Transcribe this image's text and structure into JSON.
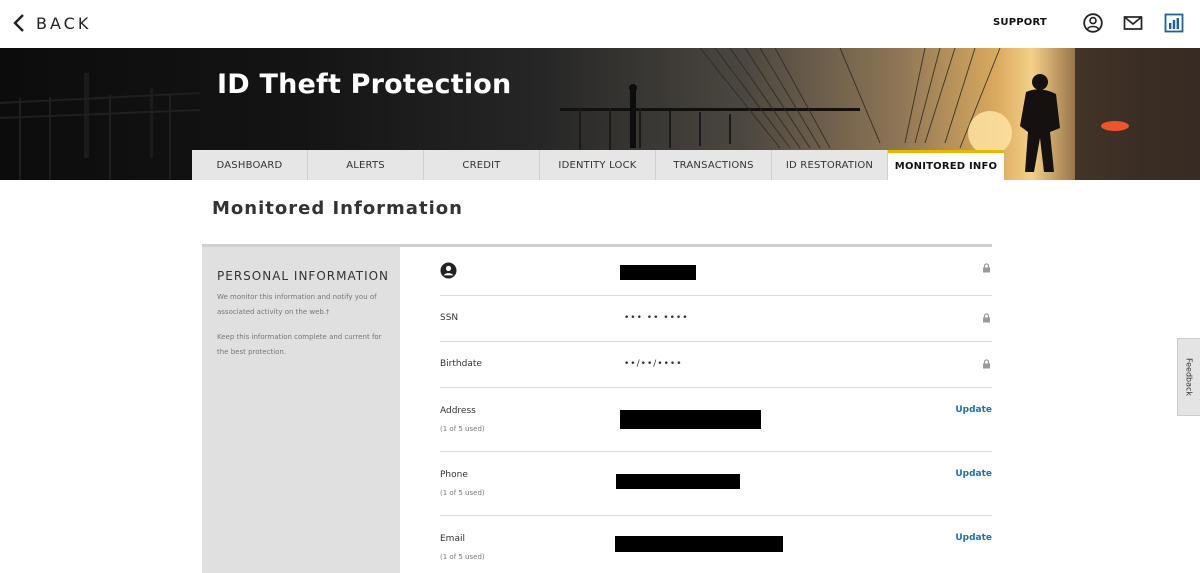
{
  "header": {
    "back_label": "BACK",
    "support_label": "SUPPORT",
    "icons": [
      "user-account-icon",
      "mail-icon",
      "dashboard-chart-icon"
    ]
  },
  "banner": {
    "title": "ID Theft Protection"
  },
  "tabs": [
    {
      "label": "DASHBOARD",
      "active": false
    },
    {
      "label": "ALERTS",
      "active": false
    },
    {
      "label": "CREDIT",
      "active": false
    },
    {
      "label": "IDENTITY LOCK",
      "active": false
    },
    {
      "label": "TRANSACTIONS",
      "active": false
    },
    {
      "label": "ID RESTORATION",
      "active": false
    },
    {
      "label": "MONITORED INFO",
      "active": true
    }
  ],
  "page": {
    "title": "Monitored Information"
  },
  "sidebar": {
    "title": "PERSONAL INFORMATION",
    "text1": "We monitor this information and notify you of associated activity on the web.†",
    "text2": "Keep this information complete and current for the best protection."
  },
  "rows": {
    "name": {
      "icon": "person-icon"
    },
    "ssn": {
      "label": "SSN",
      "value": "••• •• ••••"
    },
    "birthdate": {
      "label": "Birthdate",
      "value": "••/••/••••"
    },
    "address": {
      "label": "Address",
      "sub": "(1 of 5 used)",
      "action": "Update"
    },
    "phone": {
      "label": "Phone",
      "sub": "(1 of 5 used)",
      "action": "Update"
    },
    "email": {
      "label": "Email",
      "sub": "(1 of 5 used)",
      "action": "Update"
    }
  },
  "feedback_label": "Feedback",
  "colors": {
    "accent_tab": "#f0b400",
    "link": "#2b6fa0",
    "sidebar_bg": "#e0e0e0"
  }
}
